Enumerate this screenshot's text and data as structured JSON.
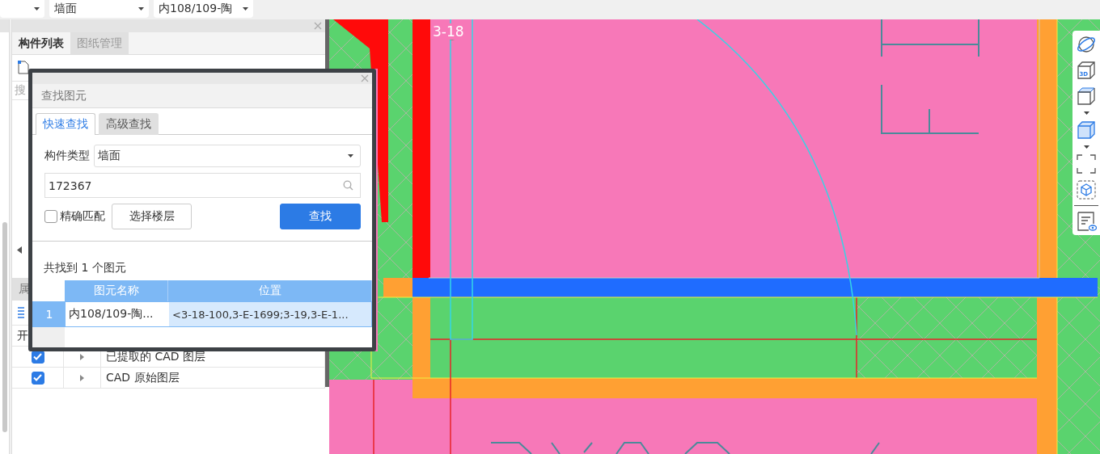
{
  "top_bar": {
    "dropdowns": [
      {
        "value": "墙面"
      },
      {
        "value": "内108/109-陶"
      }
    ]
  },
  "left_panel": {
    "tabs": [
      {
        "label": "构件列表",
        "selected": true
      },
      {
        "label": "图纸管理",
        "selected": false
      }
    ],
    "search_placeholder": "搜",
    "section_tab": "属",
    "layers_header": "开",
    "layers": [
      {
        "label": "已提取的 CAD 图层",
        "checked": true
      },
      {
        "label": "CAD 原始图层",
        "checked": true
      }
    ]
  },
  "canvas": {
    "axis_label": "3-18"
  },
  "view_toolbar": {
    "view_3d_label": "3D"
  },
  "dialog": {
    "title": "查找图元",
    "tabs": [
      {
        "label": "快速查找",
        "selected": true
      },
      {
        "label": "高级查找",
        "selected": false
      }
    ],
    "type_label": "构件类型",
    "type_value": "墙面",
    "search_value": "172367",
    "exact_match": {
      "label": "精确匹配",
      "checked": false
    },
    "floor_button": "选择楼层",
    "find_button": "查找",
    "result_summary": "共找到 1 个图元",
    "table": {
      "columns": [
        "图元名称",
        "位置"
      ],
      "rows": [
        {
          "index": "1",
          "name": "内108/109-陶...",
          "position": "<3-18-100,3-E-1699;3-19,3-E-1...",
          "selected": true
        }
      ]
    }
  }
}
